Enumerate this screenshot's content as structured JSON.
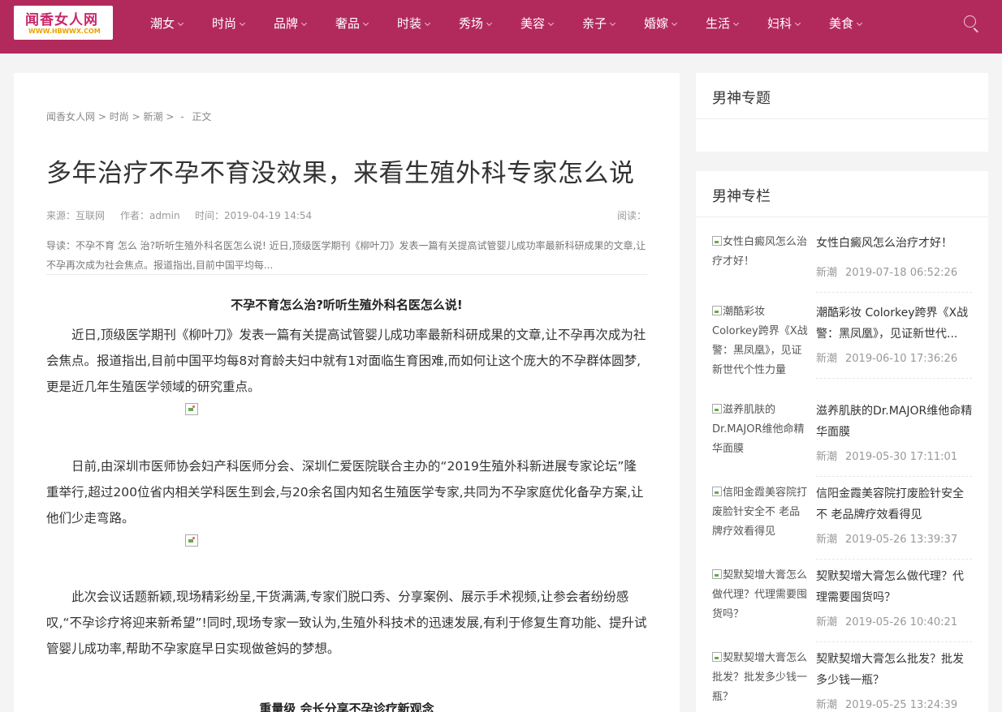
{
  "header": {
    "logo_main": "闻香女人网",
    "logo_sub": "WWW.HBWWX.COM",
    "nav": [
      "潮女",
      "时尚",
      "品牌",
      "奢品",
      "时装",
      "秀场",
      "美容",
      "亲子",
      "婚嫁",
      "生活",
      "妇科",
      "美食"
    ],
    "search_icon": "search-icon"
  },
  "article": {
    "breadcrumb": [
      "闻香女人网",
      ">",
      "时尚",
      ">",
      "新潮",
      ">",
      "-",
      "正文"
    ],
    "title": "多年治疗不孕不育没效果，来看生殖外科专家怎么说",
    "source": "来源：互联网",
    "author": "作者：admin",
    "time": "时间：2019-04-19 14:54",
    "views": "阅读：",
    "intro": "导读：不孕不育 怎么 治?听听生殖外科名医怎么说! 近日,顶级医学期刊《柳叶刀》发表一篇有关提高试管婴儿成功率最新科研成果的文章,让不孕再次成为社会焦点。报道指出,目前中国平均每...",
    "subtitle1": "不孕不育怎么治?听听生殖外科名医怎么说!",
    "para1": "近日,顶级医学期刊《柳叶刀》发表一篇有关提高试管婴儿成功率最新科研成果的文章,让不孕再次成为社会焦点。报道指出,目前中国平均每8对育龄夫妇中就有1对面临生育困难,而如何让这个庞大的不孕群体圆梦,更是近几年生殖医学领域的研究重点。",
    "para2": "日前,由深圳市医师协会妇产科医师分会、深圳仁爱医院联合主办的“2019生殖外科新进展专家论坛”隆重举行,超过200位省内相关学科医生到会,与20余名国内知名生殖医学专家,共同为不孕家庭优化备孕方案,让他们少走弯路。",
    "para3": "此次会议话题新颖,现场精彩纷呈,干货满满,专家们脱口秀、分享案例、展示手术视频,让参会者纷纷感叹,“不孕诊疗将迎来新希望”!同时,现场专家一致认为,生殖外科技术的迅速发展,有利于修复生育功能、提升试管婴儿成功率,帮助不孕家庭早日实现做爸妈的梦想。",
    "subtitle2": "重量级 会长分享不孕诊疗新观念"
  },
  "sidebar": {
    "box1_title": "男神专题",
    "box2_title": "男神专栏",
    "items": [
      {
        "thumb_alt": "女性白癜风怎么治疗才好！",
        "title": "女性白癜风怎么治疗才好！",
        "category": "新潮",
        "time": "2019-07-18 06:52:26"
      },
      {
        "thumb_alt": "潮酷彩妆 Colorkey跨界《X战警：黑凤凰》，见证新世代个性力量",
        "title": "潮酷彩妆 Colorkey跨界《X战警：黑凤凰》，见证新世代...",
        "category": "新潮",
        "time": "2019-06-10 17:36:26"
      },
      {
        "thumb_alt": "滋养肌肤的Dr.MAJOR维他命精华面膜",
        "title": "滋养肌肤的Dr.MAJOR维他命精华面膜",
        "category": "新潮",
        "time": "2019-05-30 17:11:01"
      },
      {
        "thumb_alt": "信阳金霞美容院打废脸针安全不 老品牌疗效看得见",
        "title": "信阳金霞美容院打废脸针安全不 老品牌疗效看得见",
        "category": "新潮",
        "time": "2019-05-26 13:39:37"
      },
      {
        "thumb_alt": "契默契增大膏怎么做代理？代理需要囤货吗？",
        "title": "契默契增大膏怎么做代理？代理需要囤货吗？",
        "category": "新潮",
        "time": "2019-05-26 10:40:21"
      },
      {
        "thumb_alt": "契默契增大膏怎么批发？批发多少钱一瓶？",
        "title": "契默契增大膏怎么批发？批发多少钱一瓶？",
        "category": "新潮",
        "time": "2019-05-25 13:24:39"
      }
    ]
  }
}
